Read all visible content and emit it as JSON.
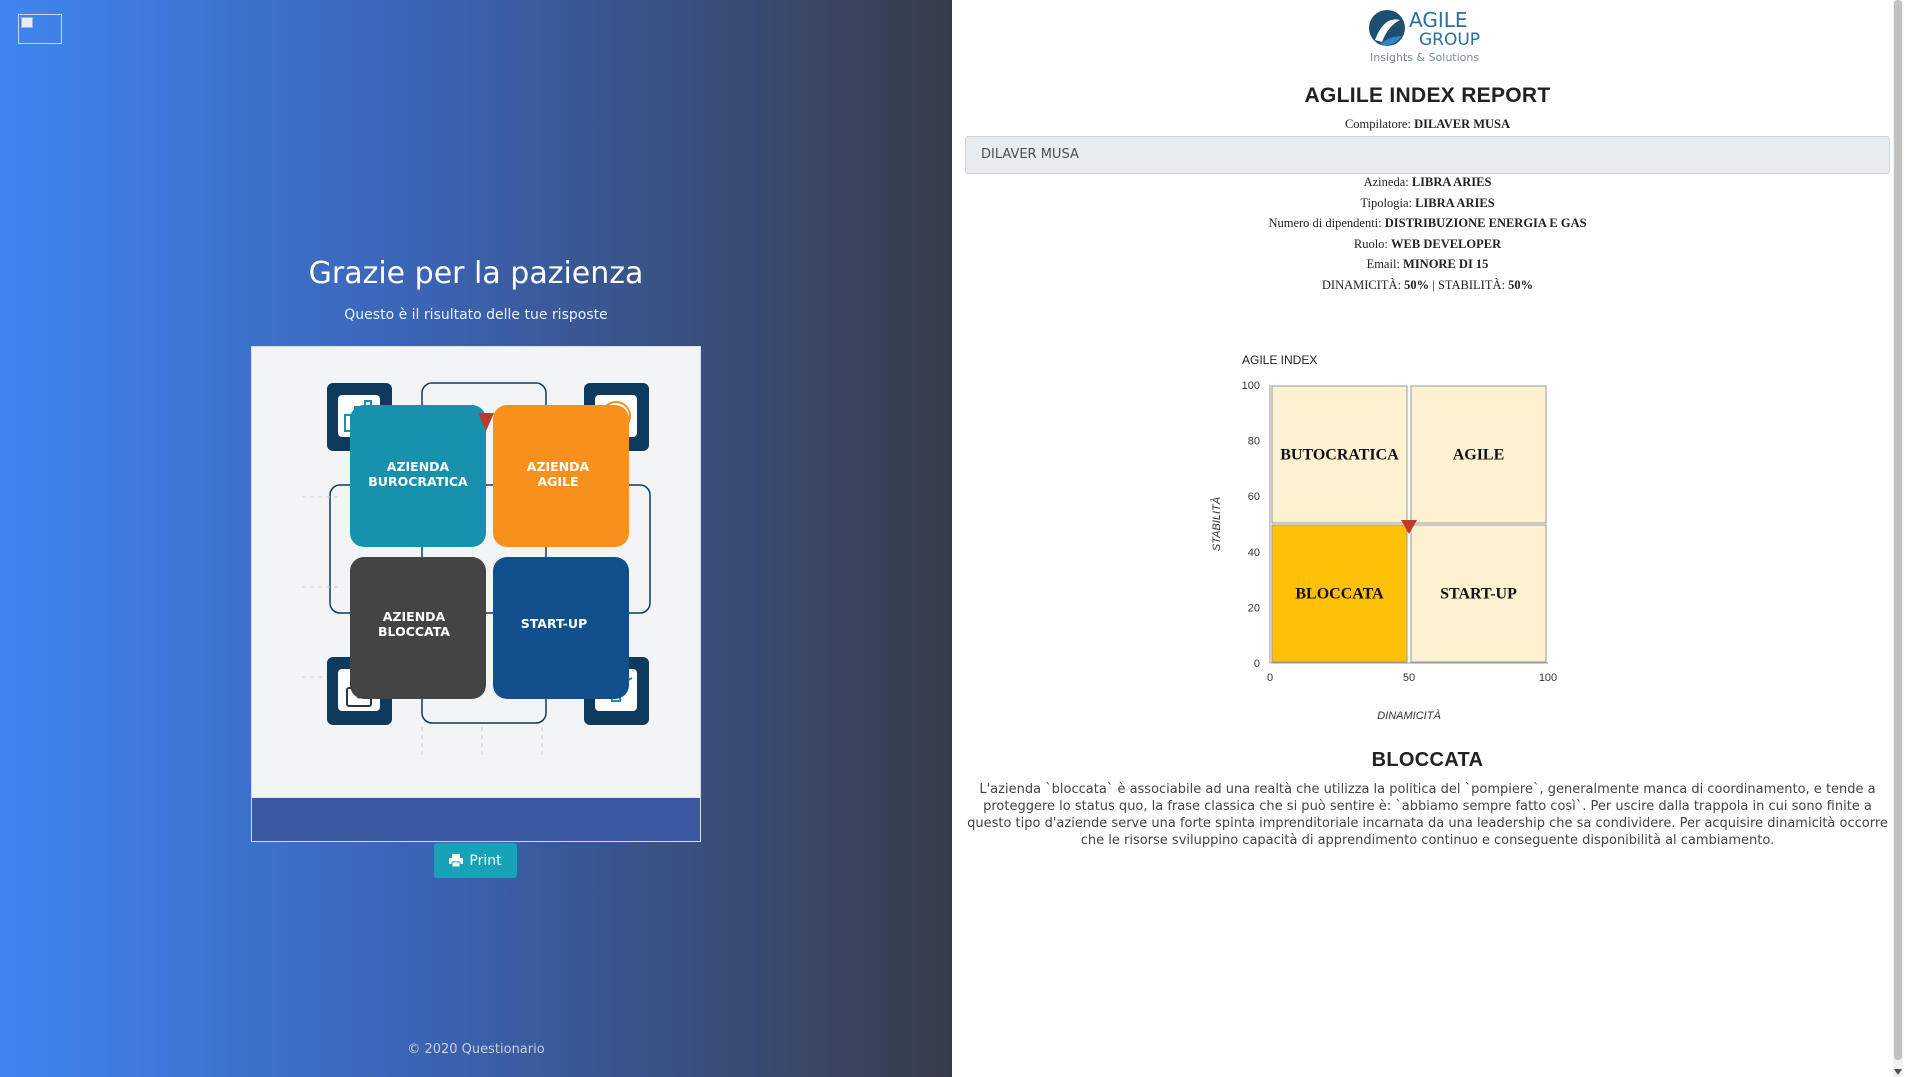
{
  "left": {
    "title": "Grazie per la pazienza",
    "subtitle": "Questo è il risultato delle tue risposte",
    "print_label": "Print",
    "copyright": "© 2020 Questionario",
    "illustration": {
      "top_left": [
        "AZIENDA",
        "BUROCRATICA"
      ],
      "top_right": [
        "AZIENDA",
        "AGILE"
      ],
      "bottom_left": [
        "AZIENDA",
        "BLOCCATA"
      ],
      "bottom_right": [
        "START-UP"
      ],
      "colors": {
        "teal": "#1791ad",
        "orange": "#f7911c",
        "dark": "#444444",
        "navy": "#11508a",
        "frame": "#0e3a5e",
        "marker": "#c0392b"
      }
    }
  },
  "logo": {
    "line1": "AGILE",
    "line2": "GROUP",
    "tagline": "Insights & Solutions"
  },
  "report": {
    "title": "AGLILE INDEX REPORT",
    "compiler_label": "Compilatore:",
    "compiler_value": "DILAVER MUSA",
    "name_field_value": "DILAVER MUSA",
    "fields": [
      {
        "label": "Azineda:",
        "value": "LIBRA ARIES"
      },
      {
        "label": "Tipologia:",
        "value": "LIBRA ARIES"
      },
      {
        "label": "Numero di dipendenti:",
        "value": "DISTRIBUZIONE ENERGIA E GAS"
      },
      {
        "label": "Ruolo:",
        "value": "WEB DEVELOPER"
      },
      {
        "label": "Email:",
        "value": "MINORE DI 15"
      }
    ],
    "scores": {
      "dyn_label": "DINAMICITÀ:",
      "dyn_value": "50%",
      "separator": "|",
      "stab_label": "STABILITÀ:",
      "stab_value": "50%"
    }
  },
  "chart_data": {
    "type": "scatter",
    "title": "AGILE INDEX",
    "xlabel": "DINAMICITÀ",
    "ylabel": "STABILITÀ",
    "xlim": [
      0,
      100
    ],
    "ylim": [
      0,
      100
    ],
    "xticks": [
      0,
      50,
      100
    ],
    "yticks": [
      0,
      20,
      40,
      60,
      80,
      100
    ],
    "quadrants": [
      {
        "label": "BUTOCRATICA",
        "x": [
          0,
          50
        ],
        "y": [
          50,
          100
        ],
        "color": "#fdf1d2"
      },
      {
        "label": "AGILE",
        "x": [
          50,
          100
        ],
        "y": [
          50,
          100
        ],
        "color": "#fdf1d2"
      },
      {
        "label": "BLOCCATA",
        "x": [
          0,
          50
        ],
        "y": [
          0,
          50
        ],
        "color": "#ffc107"
      },
      {
        "label": "START-UP",
        "x": [
          50,
          100
        ],
        "y": [
          0,
          50
        ],
        "color": "#fdf1d2"
      }
    ],
    "point": {
      "x": 50,
      "y": 50,
      "marker": "triangle-down",
      "color": "#c0392b"
    }
  },
  "result": {
    "heading": "BLOCCATA",
    "description": "L'azienda `bloccata` è associabile ad una realtà che utilizza la politica del `pompiere`, generalmente manca di coordinamento, e tende a proteggere lo status quo, la frase classica che si può sentire è: `abbiamo sempre fatto così`. Per uscire dalla trappola in cui sono finite a questo tipo d'aziende serve una forte spinta imprenditoriale incarnata da una leadership che sa condividere. Per acquisire dinamicità occorre che le risorse sviluppino capacità di apprendimento continuo e conseguente disponibilità al cambiamento."
  }
}
